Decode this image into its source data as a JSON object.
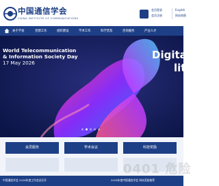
{
  "header": {
    "logo_cn": "中国通信学会",
    "logo_en": "CHINA INSTITUTE OF COMMUNICATIONS",
    "user_line1": "会员登录",
    "user_line2": "会员注册",
    "side_line1": "English",
    "side_line2": "网站地图"
  },
  "nav": {
    "items": [
      "关于学会",
      "党建工作",
      "组织建设",
      "学术工作",
      "科学普及",
      "咨询服务",
      "产业人才"
    ]
  },
  "hero": {
    "title_line1": "World Telecommunication",
    "title_line2": "& Information Society Day",
    "date": "17 May 2026",
    "right_word1": "Digita",
    "right_word2": "lit"
  },
  "services": {
    "items": [
      "会员服务",
      "学术会议",
      "科技奖励"
    ]
  },
  "bottom": {
    "left_text": "中国通信学会 2026年度工作会议召开",
    "right_text": "2026年度中国通信学会 科技奖励推荐"
  },
  "watermark": "0401 危险",
  "colors": {
    "brand": "#1d3f86",
    "nav": "#1d3f86",
    "hero_bg": "#12205a"
  },
  "icons": {
    "logo": "cic-logo-icon",
    "user": "user-icon",
    "home": "home-icon"
  }
}
